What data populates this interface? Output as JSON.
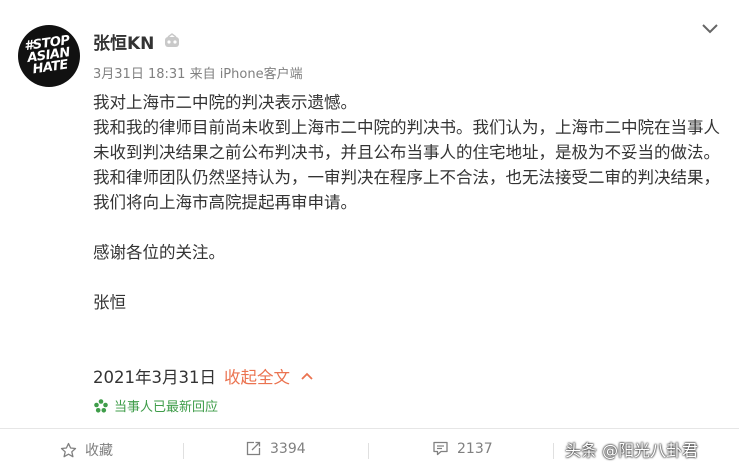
{
  "post": {
    "avatar_text": "#STOP ASIAN HATE",
    "username": "张恒KN",
    "time": "3月31日 18:31",
    "source": "来自 iPhone客户端",
    "paragraphs": [
      "我对上海市二中院的判决表示遗憾。",
      "我和我的律师目前尚未收到上海市二中院的判决书。我们认为，上海市二中院在当事人未收到判决结果之前公布判决书，并且公布当事人的住宅地址，是极为不妥当的做法。",
      "我和律师团队仍然坚持认为，一审判决在程序上不合法，也无法接受二审的判决结果，我们将向上海市高院提起再审申请。"
    ],
    "thanks": "感谢各位的关注。",
    "signature": "张恒",
    "date": "2021年3月31日",
    "collapse_label": "收起全文",
    "respond_label": "当事人已最新回应"
  },
  "actions": {
    "favorite": "收藏",
    "repost": "3394",
    "comment": "2137"
  },
  "watermark": "头条 @阳光八卦君",
  "colors": {
    "link": "#eb7350",
    "respond_green": "#3f9d4a",
    "muted": "#808080"
  }
}
